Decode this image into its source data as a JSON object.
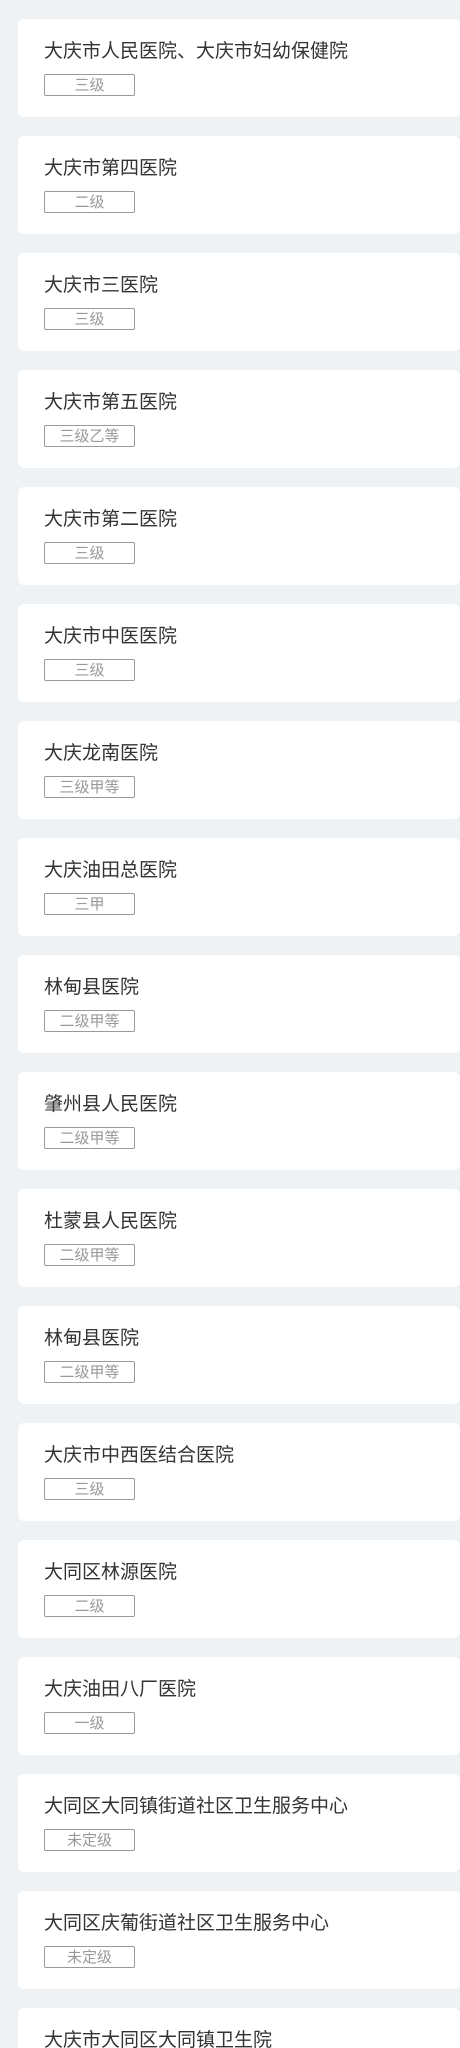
{
  "hospitals": [
    {
      "name": "大庆市人民医院、大庆市妇幼保健院",
      "level": "三级"
    },
    {
      "name": "大庆市第四医院",
      "level": "二级"
    },
    {
      "name": "大庆市三医院",
      "level": "三级"
    },
    {
      "name": "大庆市第五医院",
      "level": "三级乙等"
    },
    {
      "name": "大庆市第二医院",
      "level": "三级"
    },
    {
      "name": "大庆市中医医院",
      "level": "三级"
    },
    {
      "name": "大庆龙南医院",
      "level": "三级甲等"
    },
    {
      "name": "大庆油田总医院",
      "level": "三甲"
    },
    {
      "name": "林甸县医院",
      "level": "二级甲等"
    },
    {
      "name": "肇州县人民医院",
      "level": "二级甲等"
    },
    {
      "name": "杜蒙县人民医院",
      "level": "二级甲等"
    },
    {
      "name": "林甸县医院",
      "level": "二级甲等"
    },
    {
      "name": "大庆市中西医结合医院",
      "level": "三级"
    },
    {
      "name": "大同区林源医院",
      "level": "二级"
    },
    {
      "name": "大庆油田八厂医院",
      "level": "一级"
    },
    {
      "name": "大同区大同镇街道社区卫生服务中心",
      "level": "未定级"
    },
    {
      "name": "大同区庆葡街道社区卫生服务中心",
      "level": "未定级"
    },
    {
      "name": "大庆市大同区大同镇卫生院",
      "level": ""
    }
  ]
}
